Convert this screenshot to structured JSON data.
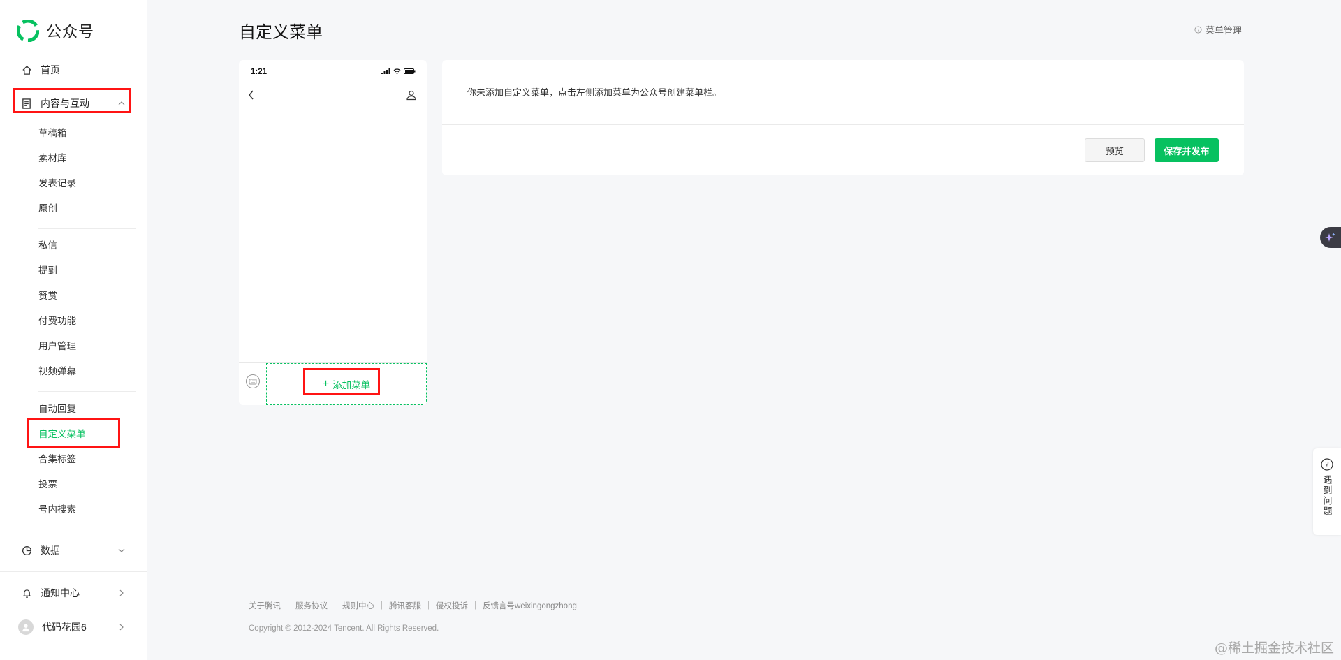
{
  "app": {
    "name": "公众号"
  },
  "sidebar": {
    "home": "首页",
    "content_group": "内容与互动",
    "group1": [
      "草稿箱",
      "素材库",
      "发表记录",
      "原创"
    ],
    "group2": [
      "私信",
      "提到",
      "赞赏",
      "付费功能",
      "用户管理",
      "视频弹幕"
    ],
    "group3": [
      "自动回复",
      "自定义菜单",
      "合集标签",
      "投票",
      "号内搜索"
    ],
    "data_group": "数据",
    "notifications": "通知中心",
    "account": "代码花园6"
  },
  "header": {
    "title": "自定义菜单",
    "menu_management": "菜单管理"
  },
  "phone": {
    "time": "1:21",
    "add_menu": "添加菜单"
  },
  "panel": {
    "message": "你未添加自定义菜单，点击左侧添加菜单为公众号创建菜单栏。",
    "preview_button": "预览",
    "publish_button": "保存并发布"
  },
  "help": {
    "label": "遇到问题"
  },
  "footer": {
    "links": [
      "关于腾讯",
      "服务协议",
      "规则中心",
      "腾讯客服",
      "侵权投诉",
      "反馈言号weixingongzhong"
    ],
    "copyright": "Copyright © 2012-2024 Tencent. All Rights Reserved."
  },
  "watermark": "@稀土掘金技术社区",
  "colors": {
    "accent": "#07c160",
    "highlight": "#ff1414"
  }
}
